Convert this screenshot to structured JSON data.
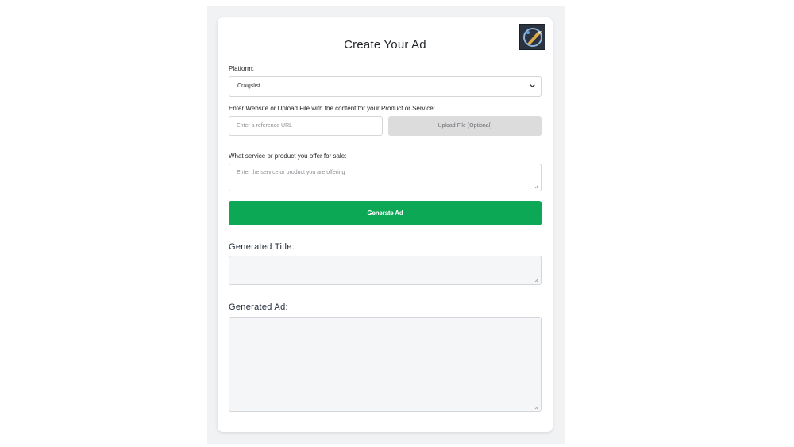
{
  "form": {
    "title": "Create Your Ad",
    "logo_icon": "ai-pen-logo",
    "platform": {
      "label": "Platform:",
      "selected": "Craigslist"
    },
    "reference": {
      "label": "Enter Website or Upload File with the content for your Product or Service:",
      "url_placeholder": "Enter a reference URL",
      "upload_label": "Upload File (Optional)"
    },
    "service": {
      "label": "What service or product you offer for sale:",
      "placeholder": "Enter the service or product you are offering"
    },
    "generate_label": "Generate Ad"
  },
  "output": {
    "title_heading": "Generated Title:",
    "ad_heading": "Generated Ad:"
  },
  "colors": {
    "accent": "#0ca855",
    "panel": "#f1f2f4",
    "upload_button": "#dcdcdc"
  }
}
